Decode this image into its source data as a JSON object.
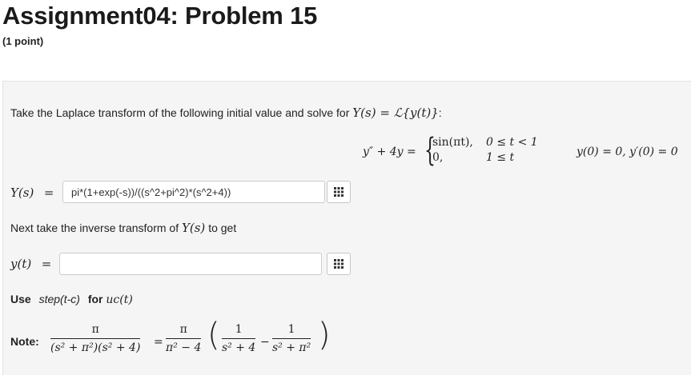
{
  "header": {
    "title": "Assignment04: Problem 15",
    "points": "(1 point)"
  },
  "problem": {
    "intro_text": "Take the Laplace transform of the following initial value and solve for",
    "intro_math": "Y(s) = ℒ{y(t)}",
    "intro_colon": ":",
    "ode_lhs": "y″ + 4y =",
    "case1_expr": "sin(πt),",
    "case1_cond": "0 ≤ t < 1",
    "case2_expr": "0,",
    "case2_cond": "1 ≤ t",
    "initial_conditions": "y(0) = 0, y′(0) = 0",
    "Y_label": "Y(s)",
    "y_label": "y(t)",
    "equals": "=",
    "answer_Y_value": "pi*(1+exp(-s))/((s^2+pi^2)*(s^2+4))",
    "answer_y_value": "",
    "next_text": "Next take the inverse transform of",
    "next_math": "Y(s)",
    "next_suffix": "to get",
    "use_label": "Use",
    "use_code": "step(t-c)",
    "use_for": "for",
    "use_math": "uc(t)",
    "note_label": "Note:",
    "note_frac1_num": "π",
    "note_frac1_den": "(s² + π²)(s² + 4)",
    "note_frac2_num": "π",
    "note_frac2_den": "π² − 4",
    "note_frac3_num": "1",
    "note_frac3_den": "s² + 4",
    "note_frac4_num": "1",
    "note_frac4_den": "s² + π²",
    "minus": "−"
  },
  "icons": {
    "equation_editor": "grid-icon"
  },
  "colors": {
    "problem_bg": "#f5f5f5",
    "input_border": "#cccccc"
  }
}
